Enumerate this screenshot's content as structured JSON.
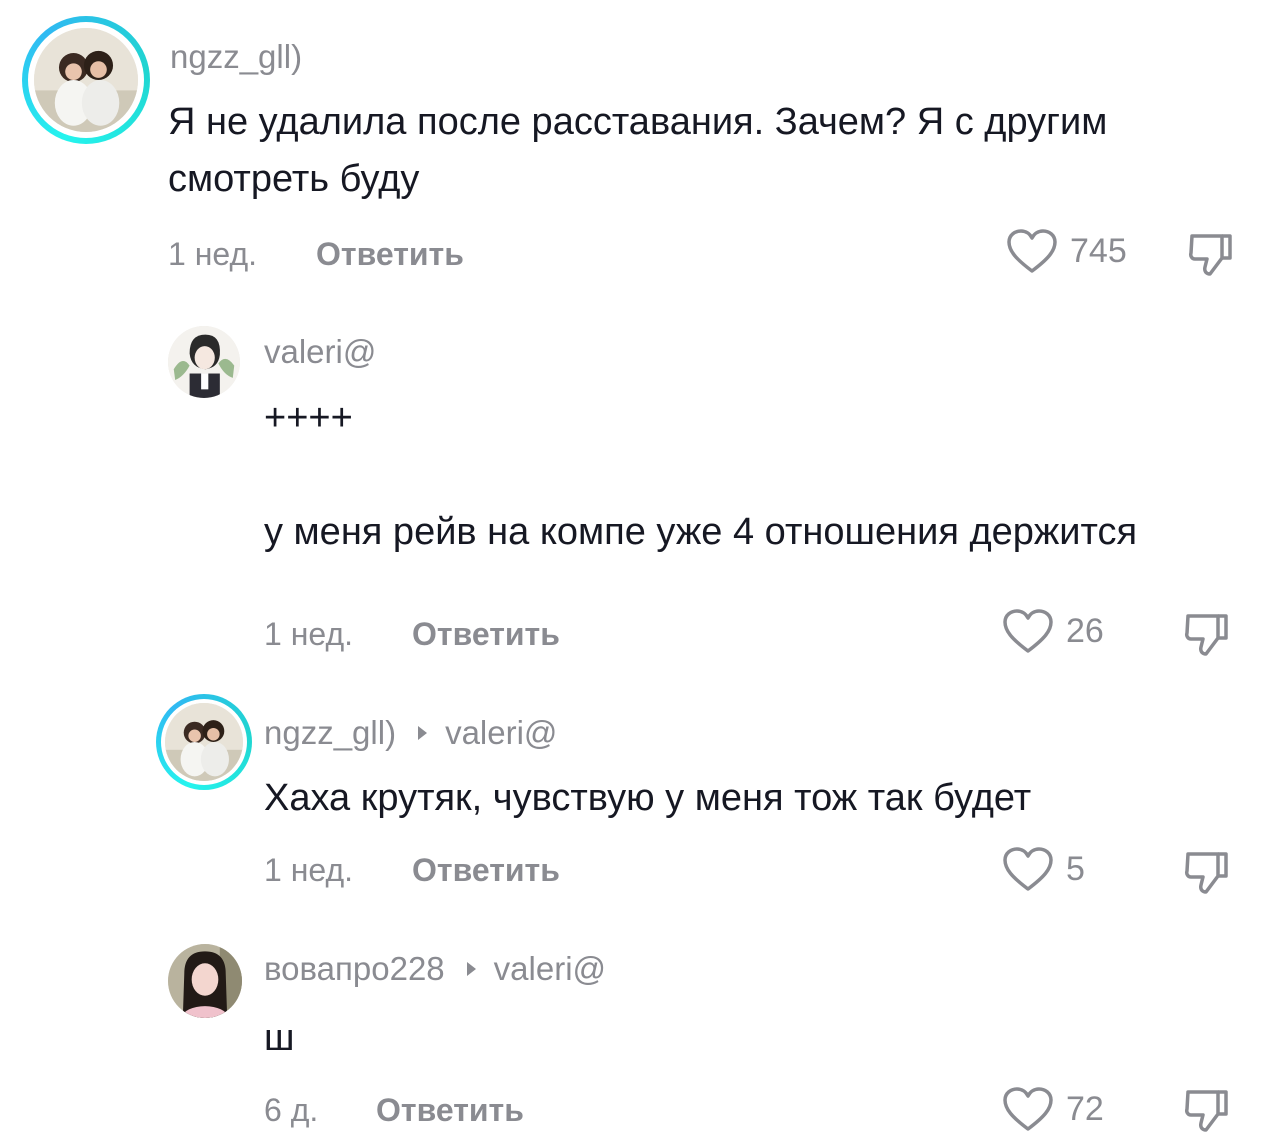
{
  "comments": [
    {
      "username": "ngzz_gll)",
      "text": "Я не удалила после расставания. Зачем? Я с другим смотреть буду",
      "time": "1 нед.",
      "reply_label": "Ответить",
      "likes": "745",
      "has_story_ring": true
    },
    {
      "username": "valeri@",
      "text": "++++\n\nу меня рейв на компе уже 4 отношения держится",
      "time": "1 нед.",
      "reply_label": "Ответить",
      "likes": "26",
      "has_story_ring": false
    },
    {
      "username": "ngzz_gll)",
      "reply_to": "valeri@",
      "text": "Хаха крутяк, чувствую у меня тож так будет",
      "time": "1 нед.",
      "reply_label": "Ответить",
      "likes": "5",
      "has_story_ring": true
    },
    {
      "username": "вовапро228",
      "reply_to": "valeri@",
      "text": "ш",
      "time": "6 д.",
      "reply_label": "Ответить",
      "likes": "72",
      "has_story_ring": false
    }
  ],
  "icons": {
    "like": "heart-outline-icon",
    "dislike": "thumbs-down-outline-icon",
    "reply_arrow": "triangle-right-icon"
  },
  "colors": {
    "ring": "#25f4ee",
    "secondary_text": "#8a8b91",
    "primary_text": "#161823"
  }
}
